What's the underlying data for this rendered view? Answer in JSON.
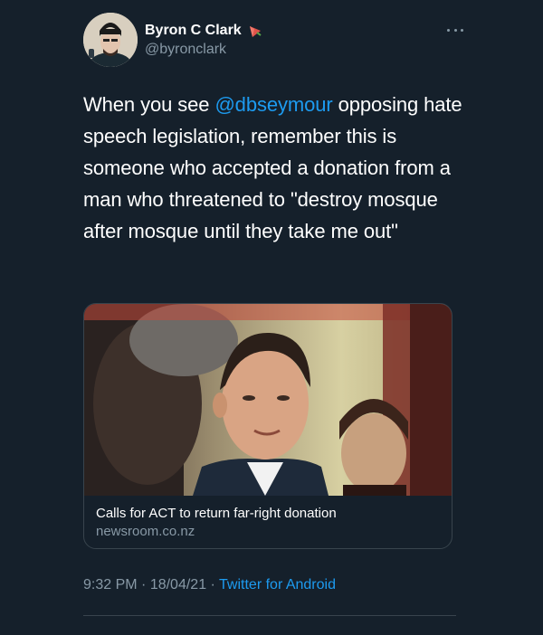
{
  "user": {
    "display_name": "Byron C Clark",
    "handle": "@byronclark",
    "name_emoji": "rose-emoji"
  },
  "tweet": {
    "text_before": "When you see ",
    "mention": "@dbseymour",
    "text_after": " opposing hate speech legislation, remember this is someone who accepted a donation from a man who threatened to \"destroy mosque after mosque until they take me out\""
  },
  "link_card": {
    "title": "Calls for ACT to return far-right donation",
    "domain": "newsroom.co.nz",
    "image": "man-in-suit-with-woman-behind-photo"
  },
  "meta": {
    "time": "9:32 PM",
    "separator1": " · ",
    "date": "18/04/21",
    "separator2": " · ",
    "source": "Twitter for Android"
  },
  "colors": {
    "background": "#15202b",
    "text": "#ffffff",
    "secondary": "#8899a6",
    "accent": "#1d9bf0",
    "border": "#38444d"
  }
}
